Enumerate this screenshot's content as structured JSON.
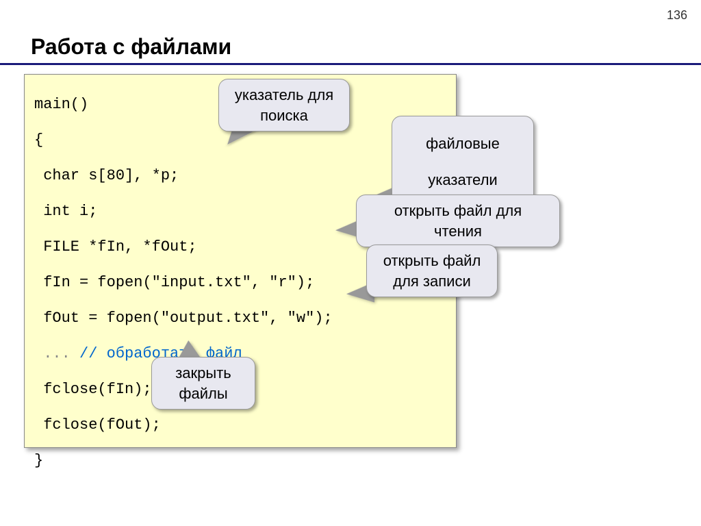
{
  "page_number": "136",
  "title": "Работа с файлами",
  "code": {
    "line1": "main()",
    "line2": "{",
    "line3": " char s[80], *p;",
    "line4": " int i;",
    "line5": " FILE *fIn, *fOut;",
    "line6": " fIn = fopen(\"input.txt\", \"r\");",
    "line7": " fOut = fopen(\"output.txt\", \"w\");",
    "line8a": " ... ",
    "line8b": "// обработать файл",
    "line9": " fclose(fIn);",
    "line10": " fclose(fOut);",
    "line11": "}"
  },
  "callouts": {
    "c1": "указатель для поиска",
    "c2": "файловые указатели",
    "c3": "открыть файл для чтения",
    "c4": "открыть файл для записи",
    "c5": "закрыть файлы"
  }
}
